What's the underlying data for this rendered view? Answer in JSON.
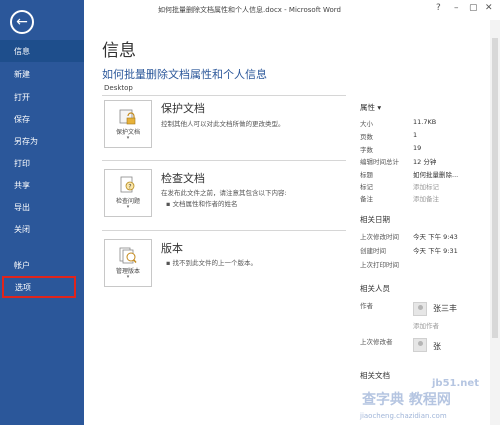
{
  "window": {
    "title": "如何批量删除文档属性和个人信息.docx - Microsoft Word",
    "help_label": "?",
    "minimize_label": "–",
    "restore_label": "▢",
    "close_label": "✕"
  },
  "sidebar": {
    "back_icon": "back-arrow-icon",
    "items": [
      {
        "label": "信息"
      },
      {
        "label": "新建"
      },
      {
        "label": "打开"
      },
      {
        "label": "保存"
      },
      {
        "label": "另存为"
      },
      {
        "label": "打印"
      },
      {
        "label": "共享"
      },
      {
        "label": "导出"
      },
      {
        "label": "关闭"
      },
      {
        "label": "帐户"
      },
      {
        "label": "选项"
      }
    ],
    "colors": {
      "background": "#2b579a",
      "active": "#1e4e8c",
      "highlight_border": "#e0241b"
    }
  },
  "main": {
    "page_title": "信息",
    "doc_title": "如何批量删除文档属性和个人信息",
    "doc_path": "Desktop",
    "sections": [
      {
        "button_label": "保护文档",
        "icon": "lock-icon",
        "heading": "保护文档",
        "desc": "控制其他人可以对此文档所做的更改类型。"
      },
      {
        "button_label": "检查问题",
        "icon": "inspect-document-icon",
        "heading": "检查文档",
        "desc": "在发布此文件之前，请注意其包含以下内容:",
        "bullet": "文档属性和作者的姓名"
      },
      {
        "button_label": "管理版本",
        "icon": "versions-icon",
        "heading": "版本",
        "desc": "找不到此文件的上一个版本。"
      }
    ]
  },
  "properties": {
    "header": "属性",
    "rows": [
      {
        "k": "大小",
        "v": "11.7KB"
      },
      {
        "k": "页数",
        "v": "1"
      },
      {
        "k": "字数",
        "v": "19"
      },
      {
        "k": "编辑时间总计",
        "v": "12 分钟"
      },
      {
        "k": "标题",
        "v": "如何批量删除..."
      },
      {
        "k": "标记",
        "v": "添加标记"
      },
      {
        "k": "备注",
        "v": "添加备注"
      }
    ],
    "dates_header": "相关日期",
    "dates": [
      {
        "k": "上次修改时间",
        "v": "今天 下午 9:43"
      },
      {
        "k": "创建时间",
        "v": "今天 下午 9:31"
      },
      {
        "k": "上次打印时间",
        "v": ""
      }
    ],
    "people_header": "相关人员",
    "author_label": "作者",
    "author_name": "张三丰",
    "add_author": "添加作者",
    "last_modified_by_label": "上次修改者",
    "last_modified_by_name": "张",
    "docs_header": "相关文档"
  },
  "watermark": {
    "line1": "jb51.net",
    "line2": "查字典 教程网",
    "line3": "jiaocheng.chazidian.com"
  }
}
